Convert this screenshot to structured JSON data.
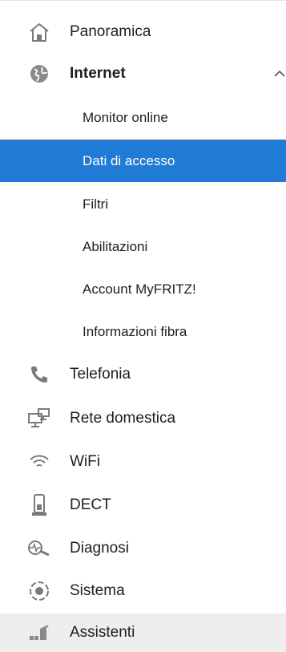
{
  "nav": {
    "overview": {
      "label": "Panoramica",
      "icon": "home-icon"
    },
    "internet": {
      "label": "Internet",
      "icon": "globe-icon",
      "expanded": true,
      "subitems": [
        {
          "label": "Monitor online"
        },
        {
          "label": "Dati di accesso",
          "selected": true
        },
        {
          "label": "Filtri"
        },
        {
          "label": "Abilitazioni"
        },
        {
          "label": "Account MyFRITZ!"
        },
        {
          "label": "Informazioni fibra"
        }
      ]
    },
    "telephony": {
      "label": "Telefonia",
      "icon": "phone-icon"
    },
    "home_network": {
      "label": "Rete domestica",
      "icon": "network-icon"
    },
    "wifi": {
      "label": "WiFi",
      "icon": "wifi-icon"
    },
    "dect": {
      "label": "DECT",
      "icon": "dect-phone-icon"
    },
    "diagnostics": {
      "label": "Diagnosi",
      "icon": "diagnostics-icon"
    },
    "system": {
      "label": "Sistema",
      "icon": "system-icon"
    },
    "wizards": {
      "label": "Assistenti",
      "icon": "wizard-icon"
    }
  },
  "colors": {
    "accent": "#1f7bd6",
    "icon": "#7a7a7a",
    "text": "#1e1e1e"
  }
}
